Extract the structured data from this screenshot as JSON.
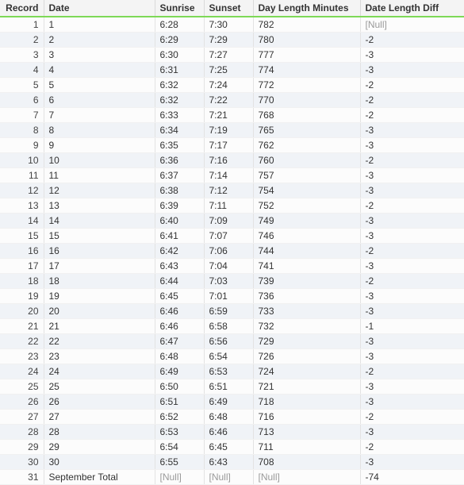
{
  "columns": {
    "record": "Record",
    "date": "Date",
    "sunrise": "Sunrise",
    "sunset": "Sunset",
    "day_length_minutes": "Day Length Minutes",
    "date_length_diff": "Date Length Diff"
  },
  "null_label": "[Null]",
  "rows": [
    {
      "record": "1",
      "date": "1",
      "sunrise": "6:28",
      "sunset": "7:30",
      "day_length_minutes": "782",
      "date_length_diff": null
    },
    {
      "record": "2",
      "date": "2",
      "sunrise": "6:29",
      "sunset": "7:29",
      "day_length_minutes": "780",
      "date_length_diff": "-2"
    },
    {
      "record": "3",
      "date": "3",
      "sunrise": "6:30",
      "sunset": "7:27",
      "day_length_minutes": "777",
      "date_length_diff": "-3"
    },
    {
      "record": "4",
      "date": "4",
      "sunrise": "6:31",
      "sunset": "7:25",
      "day_length_minutes": "774",
      "date_length_diff": "-3"
    },
    {
      "record": "5",
      "date": "5",
      "sunrise": "6:32",
      "sunset": "7:24",
      "day_length_minutes": "772",
      "date_length_diff": "-2"
    },
    {
      "record": "6",
      "date": "6",
      "sunrise": "6:32",
      "sunset": "7:22",
      "day_length_minutes": "770",
      "date_length_diff": "-2"
    },
    {
      "record": "7",
      "date": "7",
      "sunrise": "6:33",
      "sunset": "7:21",
      "day_length_minutes": "768",
      "date_length_diff": "-2"
    },
    {
      "record": "8",
      "date": "8",
      "sunrise": "6:34",
      "sunset": "7:19",
      "day_length_minutes": "765",
      "date_length_diff": "-3"
    },
    {
      "record": "9",
      "date": "9",
      "sunrise": "6:35",
      "sunset": "7:17",
      "day_length_minutes": "762",
      "date_length_diff": "-3"
    },
    {
      "record": "10",
      "date": "10",
      "sunrise": "6:36",
      "sunset": "7:16",
      "day_length_minutes": "760",
      "date_length_diff": "-2"
    },
    {
      "record": "11",
      "date": "11",
      "sunrise": "6:37",
      "sunset": "7:14",
      "day_length_minutes": "757",
      "date_length_diff": "-3"
    },
    {
      "record": "12",
      "date": "12",
      "sunrise": "6:38",
      "sunset": "7:12",
      "day_length_minutes": "754",
      "date_length_diff": "-3"
    },
    {
      "record": "13",
      "date": "13",
      "sunrise": "6:39",
      "sunset": "7:11",
      "day_length_minutes": "752",
      "date_length_diff": "-2"
    },
    {
      "record": "14",
      "date": "14",
      "sunrise": "6:40",
      "sunset": "7:09",
      "day_length_minutes": "749",
      "date_length_diff": "-3"
    },
    {
      "record": "15",
      "date": "15",
      "sunrise": "6:41",
      "sunset": "7:07",
      "day_length_minutes": "746",
      "date_length_diff": "-3"
    },
    {
      "record": "16",
      "date": "16",
      "sunrise": "6:42",
      "sunset": "7:06",
      "day_length_minutes": "744",
      "date_length_diff": "-2"
    },
    {
      "record": "17",
      "date": "17",
      "sunrise": "6:43",
      "sunset": "7:04",
      "day_length_minutes": "741",
      "date_length_diff": "-3"
    },
    {
      "record": "18",
      "date": "18",
      "sunrise": "6:44",
      "sunset": "7:03",
      "day_length_minutes": "739",
      "date_length_diff": "-2"
    },
    {
      "record": "19",
      "date": "19",
      "sunrise": "6:45",
      "sunset": "7:01",
      "day_length_minutes": "736",
      "date_length_diff": "-3"
    },
    {
      "record": "20",
      "date": "20",
      "sunrise": "6:46",
      "sunset": "6:59",
      "day_length_minutes": "733",
      "date_length_diff": "-3"
    },
    {
      "record": "21",
      "date": "21",
      "sunrise": "6:46",
      "sunset": "6:58",
      "day_length_minutes": "732",
      "date_length_diff": "-1"
    },
    {
      "record": "22",
      "date": "22",
      "sunrise": "6:47",
      "sunset": "6:56",
      "day_length_minutes": "729",
      "date_length_diff": "-3"
    },
    {
      "record": "23",
      "date": "23",
      "sunrise": "6:48",
      "sunset": "6:54",
      "day_length_minutes": "726",
      "date_length_diff": "-3"
    },
    {
      "record": "24",
      "date": "24",
      "sunrise": "6:49",
      "sunset": "6:53",
      "day_length_minutes": "724",
      "date_length_diff": "-2"
    },
    {
      "record": "25",
      "date": "25",
      "sunrise": "6:50",
      "sunset": "6:51",
      "day_length_minutes": "721",
      "date_length_diff": "-3"
    },
    {
      "record": "26",
      "date": "26",
      "sunrise": "6:51",
      "sunset": "6:49",
      "day_length_minutes": "718",
      "date_length_diff": "-3"
    },
    {
      "record": "27",
      "date": "27",
      "sunrise": "6:52",
      "sunset": "6:48",
      "day_length_minutes": "716",
      "date_length_diff": "-2"
    },
    {
      "record": "28",
      "date": "28",
      "sunrise": "6:53",
      "sunset": "6:46",
      "day_length_minutes": "713",
      "date_length_diff": "-3"
    },
    {
      "record": "29",
      "date": "29",
      "sunrise": "6:54",
      "sunset": "6:45",
      "day_length_minutes": "711",
      "date_length_diff": "-2"
    },
    {
      "record": "30",
      "date": "30",
      "sunrise": "6:55",
      "sunset": "6:43",
      "day_length_minutes": "708",
      "date_length_diff": "-3"
    },
    {
      "record": "31",
      "date": "September Total",
      "sunrise": null,
      "sunset": null,
      "day_length_minutes": null,
      "date_length_diff": "-74"
    }
  ]
}
